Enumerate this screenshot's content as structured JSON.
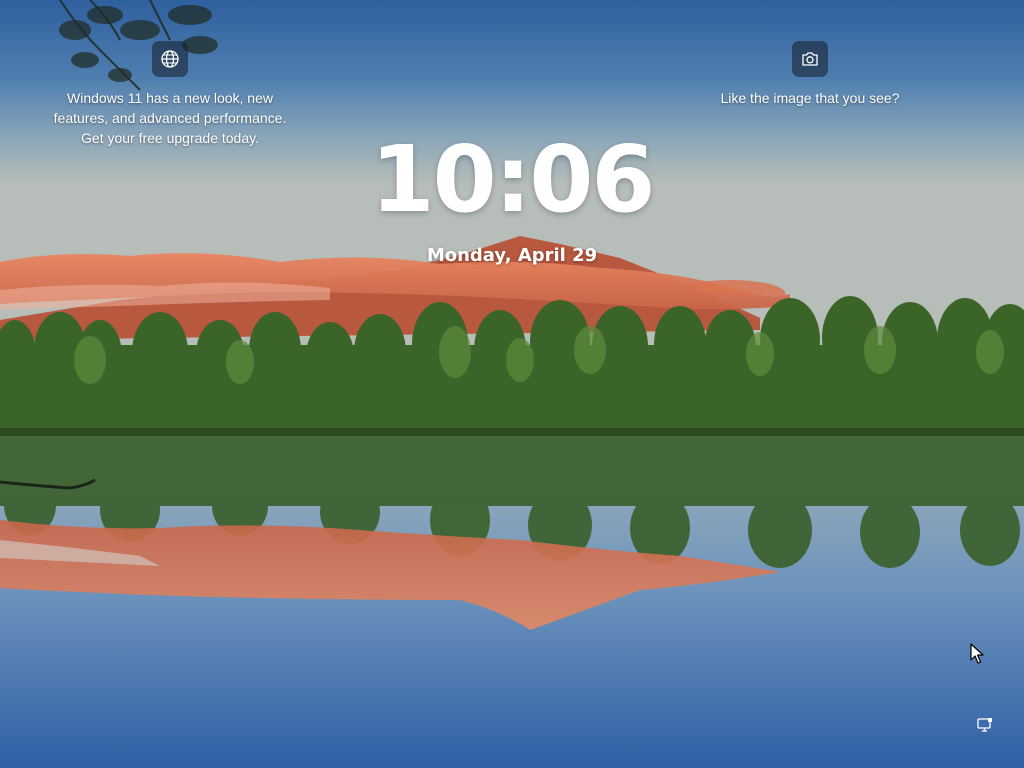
{
  "lockscreen": {
    "time": "10:06",
    "date": "Monday, April 29"
  },
  "spotlight": {
    "upgrade_promo": [
      "Windows 11 has a new look, new",
      "features, and advanced performance.",
      "Get your free upgrade today."
    ],
    "like_prompt": "Like the image that you see?"
  },
  "icons": {
    "promo": "globe-icon",
    "like": "camera-icon",
    "tray": "network-icon",
    "pointer": "mouse-cursor-icon"
  },
  "colors": {
    "sky_top": "#3b6eaa",
    "sky_horizon": "#a9b7bf",
    "clouds": "#e0714a",
    "trees": "#3f6b2a",
    "water": "#4b7cb8",
    "text": "#ffffff"
  }
}
